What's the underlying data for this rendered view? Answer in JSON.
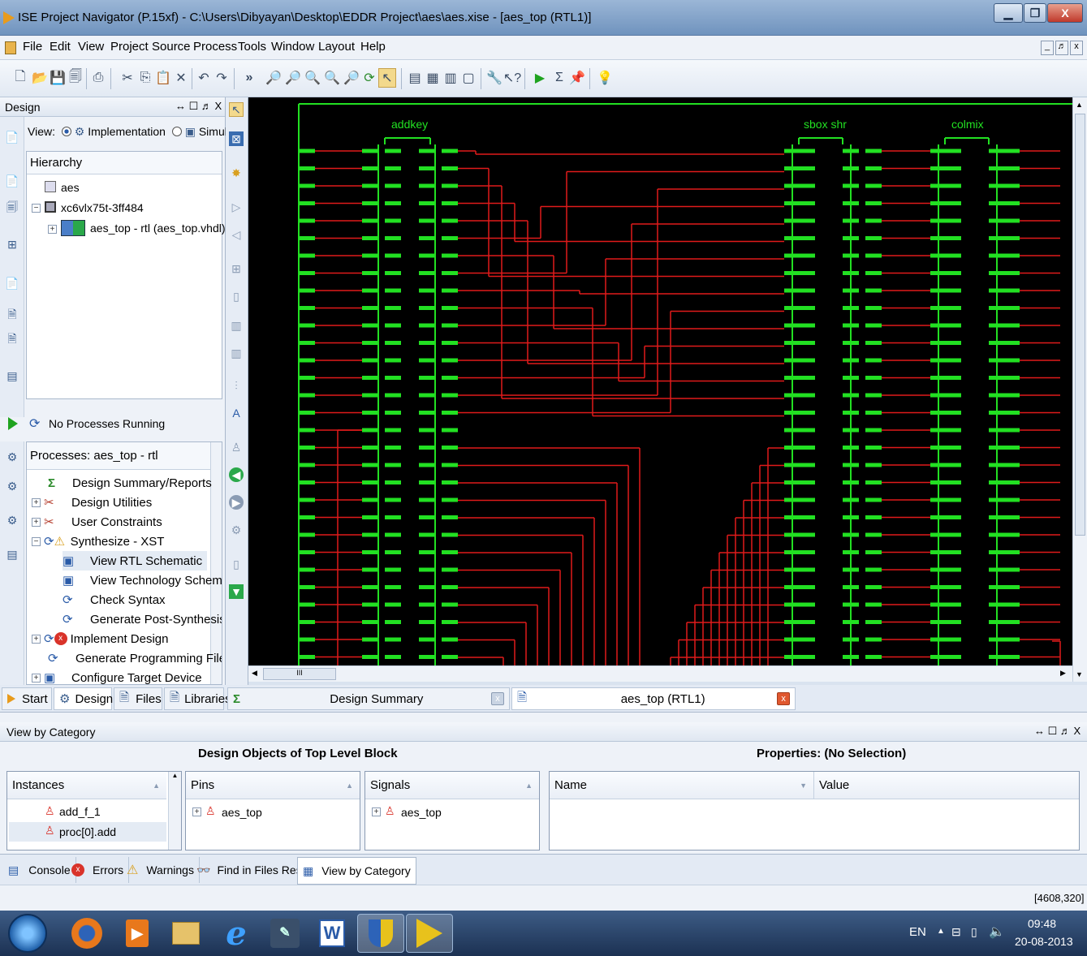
{
  "window": {
    "title": "ISE Project Navigator (P.15xf) - C:\\Users\\Dibyayan\\Desktop\\EDDR Project\\aes\\aes.xise - [aes_top (RTL1)]"
  },
  "menu": [
    "File",
    "Edit",
    "View",
    "Project",
    "Source",
    "Process",
    "Tools",
    "Window",
    "Layout",
    "Help"
  ],
  "design_panel": {
    "title": "Design",
    "header_controls": "↔ ☐ ♬ X",
    "view_label": "View:",
    "view_implementation": "Implementation",
    "view_simulation": "Simulation",
    "hierarchy_title": "Hierarchy",
    "tree": [
      "aes",
      "xc6vlx75t-3ff484",
      "aes_top - rtl (aes_top.vhdl)"
    ]
  },
  "processes": {
    "status": "No Processes Running",
    "title": "Processes: aes_top - rtl",
    "items": [
      {
        "label": "Design Summary/Reports",
        "icon": "sigma-icon"
      },
      {
        "label": "Design Utilities",
        "icon": "tools-icon"
      },
      {
        "label": "User Constraints",
        "icon": "tools-icon"
      },
      {
        "label": "Synthesize - XST",
        "icon": "warning-icon"
      },
      {
        "label": "View RTL Schematic",
        "icon": "schematic-icon"
      },
      {
        "label": "View Technology Schematic",
        "icon": "schematic-icon"
      },
      {
        "label": "Check Syntax",
        "icon": "refresh-icon"
      },
      {
        "label": "Generate Post-Synthesis Si...",
        "icon": "refresh-icon"
      },
      {
        "label": "Implement Design",
        "icon": "error-icon"
      },
      {
        "label": "Generate Programming File",
        "icon": "refresh-icon"
      },
      {
        "label": "Configure Target Device",
        "icon": "device-icon"
      }
    ]
  },
  "schematic": {
    "blocks": [
      "addkey",
      "sbox shr",
      "colmix"
    ],
    "scroll_marker": "III"
  },
  "tabs": {
    "start": "Start",
    "design": "Design",
    "files": "Files",
    "libraries": "Libraries",
    "design_summary": "Design Summary",
    "rtl": "aes_top (RTL1)"
  },
  "view_by_category": {
    "title": "View by Category",
    "header_controls": "↔ ☐ ♬ X",
    "left_heading": "Design Objects of Top Level Block",
    "right_heading": "Properties: (No Selection)",
    "instances_header": "Instances",
    "instances": [
      "add_f_1",
      "proc[0].add"
    ],
    "pins_header": "Pins",
    "pins": [
      "aes_top"
    ],
    "signals_header": "Signals",
    "signals": [
      "aes_top"
    ],
    "name_header": "Name",
    "value_header": "Value"
  },
  "bottom_tabs": [
    "Console",
    "Errors",
    "Warnings",
    "Find in Files Results",
    "View by Category"
  ],
  "status": {
    "coords": "[4608,320]"
  },
  "taskbar": {
    "lang": "EN",
    "time": "09:48",
    "date": "20-08-2013"
  },
  "colors": {
    "schematic_bg": "#000000",
    "pin_green": "#22e022",
    "wire_red": "#e01b1b"
  }
}
